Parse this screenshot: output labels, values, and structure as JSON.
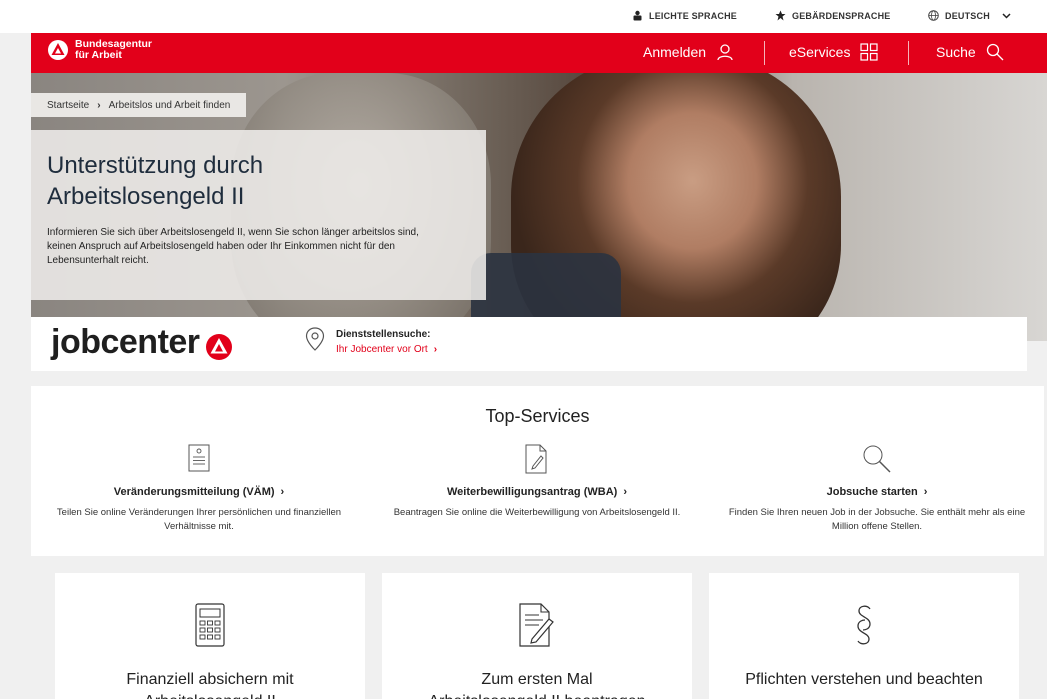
{
  "utility": {
    "easy_language": "LEICHTE SPRACHE",
    "sign_language": "GEBÄRDENSPRACHE",
    "language": "DEUTSCH"
  },
  "header": {
    "logo_line1": "Bundesagentur",
    "logo_line2": "für Arbeit",
    "login": "Anmelden",
    "eservices": "eServices",
    "search": "Suche"
  },
  "breadcrumb": {
    "items": [
      "Startseite",
      "Arbeitslos und Arbeit finden"
    ]
  },
  "hero": {
    "title_line1": "Unterstützung durch",
    "title_line2": "Arbeitslosengeld II",
    "text": "Informieren Sie sich über Arbeitslosengeld II, wenn Sie schon länger arbeitslos sind, keinen Anspruch auf Arbeitslosengeld haben oder Ihr Einkommen nicht für den Lebensunterhalt reicht."
  },
  "jobcenter": {
    "logo_text": "jobcenter",
    "finder_label": "Dienststellensuche:",
    "finder_link": "Ihr Jobcenter vor Ort"
  },
  "services": {
    "title": "Top-Services",
    "items": [
      {
        "icon": "document-icon",
        "title": "Veränderungsmitteilung (VÄM)",
        "text": "Teilen Sie online Veränderungen Ihrer persönlichen und finanziellen Verhältnisse mit."
      },
      {
        "icon": "edit-document-icon",
        "title": "Weiterbewilligungsantrag (WBA)",
        "text": "Beantragen Sie online die Weiterbewilligung von Arbeitslosengeld II."
      },
      {
        "icon": "search-icon",
        "title": "Jobsuche starten",
        "text": "Finden Sie Ihren neuen Job in der Jobsuche. Sie enthält mehr als eine Million offene Stellen."
      }
    ]
  },
  "cards": [
    {
      "icon": "calculator-icon",
      "title_line1": "Finanziell absichern mit",
      "title_line2": "Arbeitslosengeld II"
    },
    {
      "icon": "form-edit-icon",
      "title_line1": "Zum ersten Mal",
      "title_line2": "Arbeitslosengeld II beantragen"
    },
    {
      "icon": "paragraph-icon",
      "title_line1": "Pflichten verstehen und beachten",
      "title_line2": ""
    }
  ],
  "colors": {
    "brand_red": "#e2001a",
    "text_dark": "#1f2d3d"
  }
}
